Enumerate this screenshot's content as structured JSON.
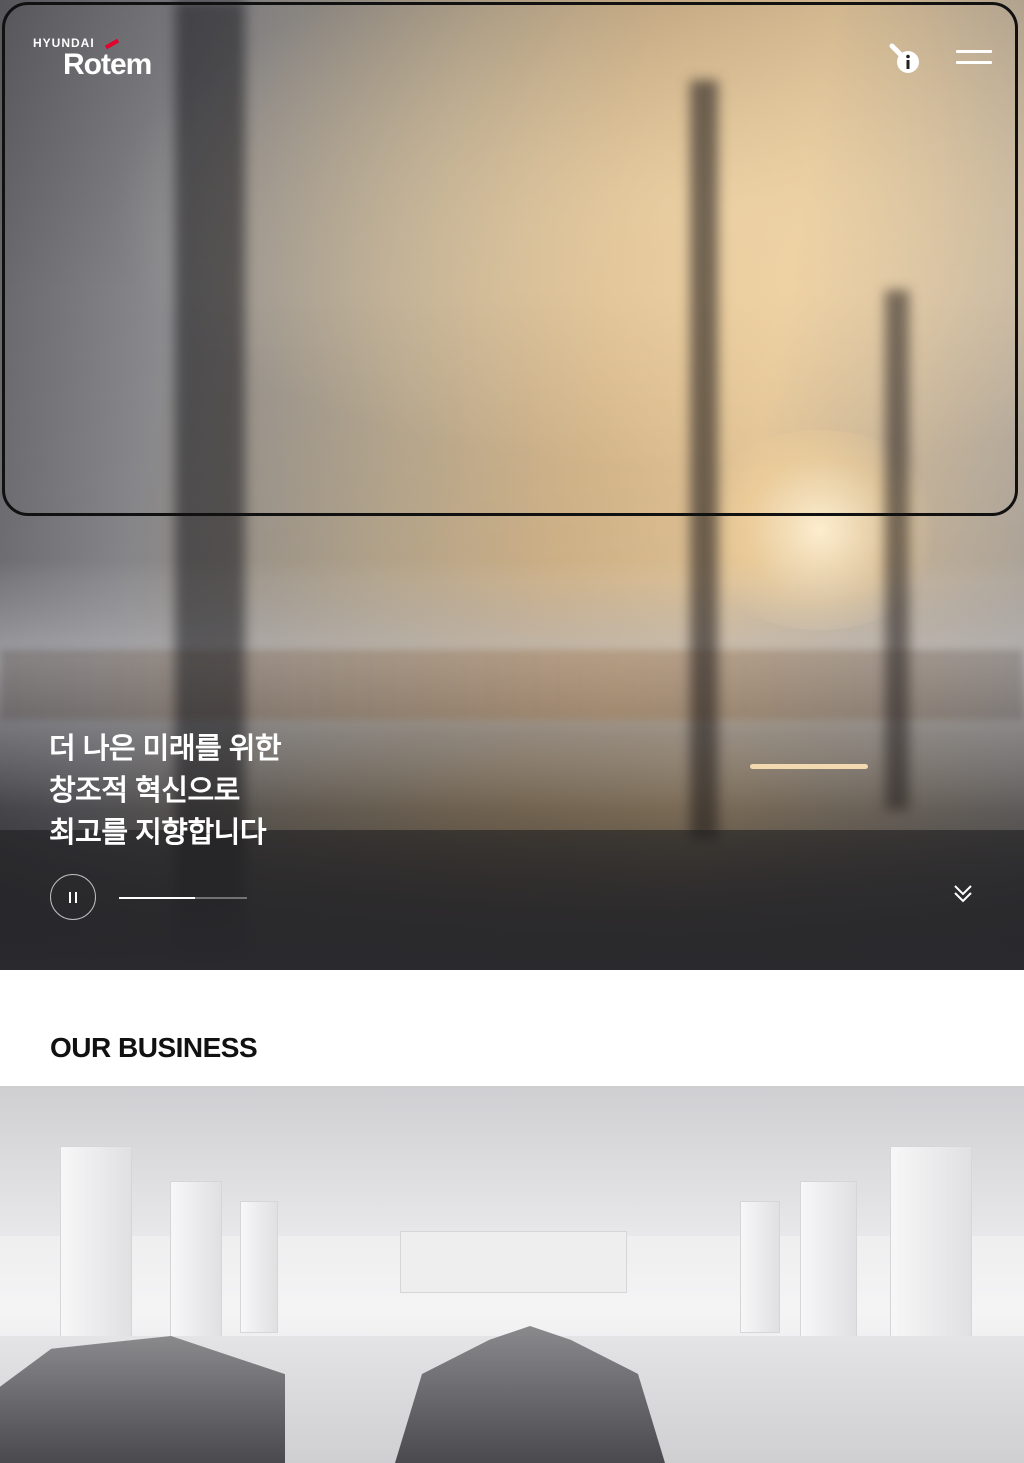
{
  "header": {
    "logo_top": "HYUNDAI",
    "logo_main": "Rotem",
    "brand_color": "#e4002b",
    "info_icon": "key-info-icon",
    "menu_icon": "hamburger-menu-icon"
  },
  "hero": {
    "headline_lines": [
      "더 나은 미래를 위한",
      "창조적 혁신으로",
      "최고를 지향합니다"
    ],
    "pause_icon": "pause-icon",
    "slide_progress": 0.59,
    "scroll_icon": "double-chevron-down-icon"
  },
  "business": {
    "title": "OUR BUSINESS"
  }
}
